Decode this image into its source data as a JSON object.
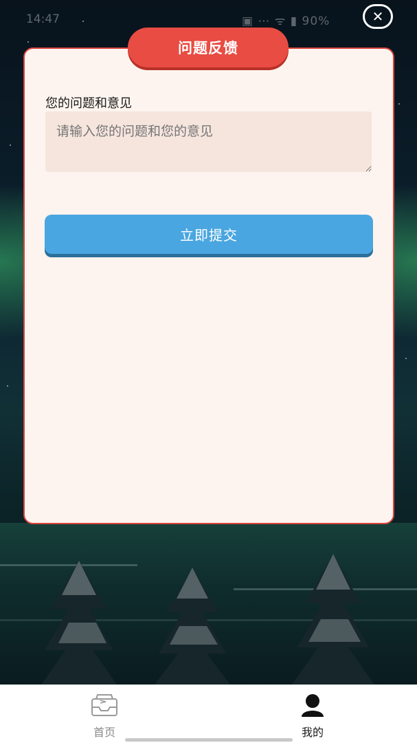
{
  "status_bar": {
    "time": "14:47",
    "right_text": "▣ ⋯ ᯤ ▮ 90%"
  },
  "close_icon": "close-icon",
  "card": {
    "title": "问题反馈",
    "field_label": "您的问题和意见",
    "textarea_placeholder": "请输入您的问题和您的意见",
    "textarea_value": "",
    "submit_label": "立即提交"
  },
  "nav": {
    "items": [
      {
        "label": "首页",
        "icon": "inbox-icon",
        "active": false
      },
      {
        "label": "我的",
        "icon": "user-icon",
        "active": true
      }
    ]
  },
  "colors": {
    "title_red": "#e84c42",
    "submit_blue": "#4aa6e0",
    "card_bg": "#fdf4ef",
    "input_bg": "#f6e5dd"
  }
}
